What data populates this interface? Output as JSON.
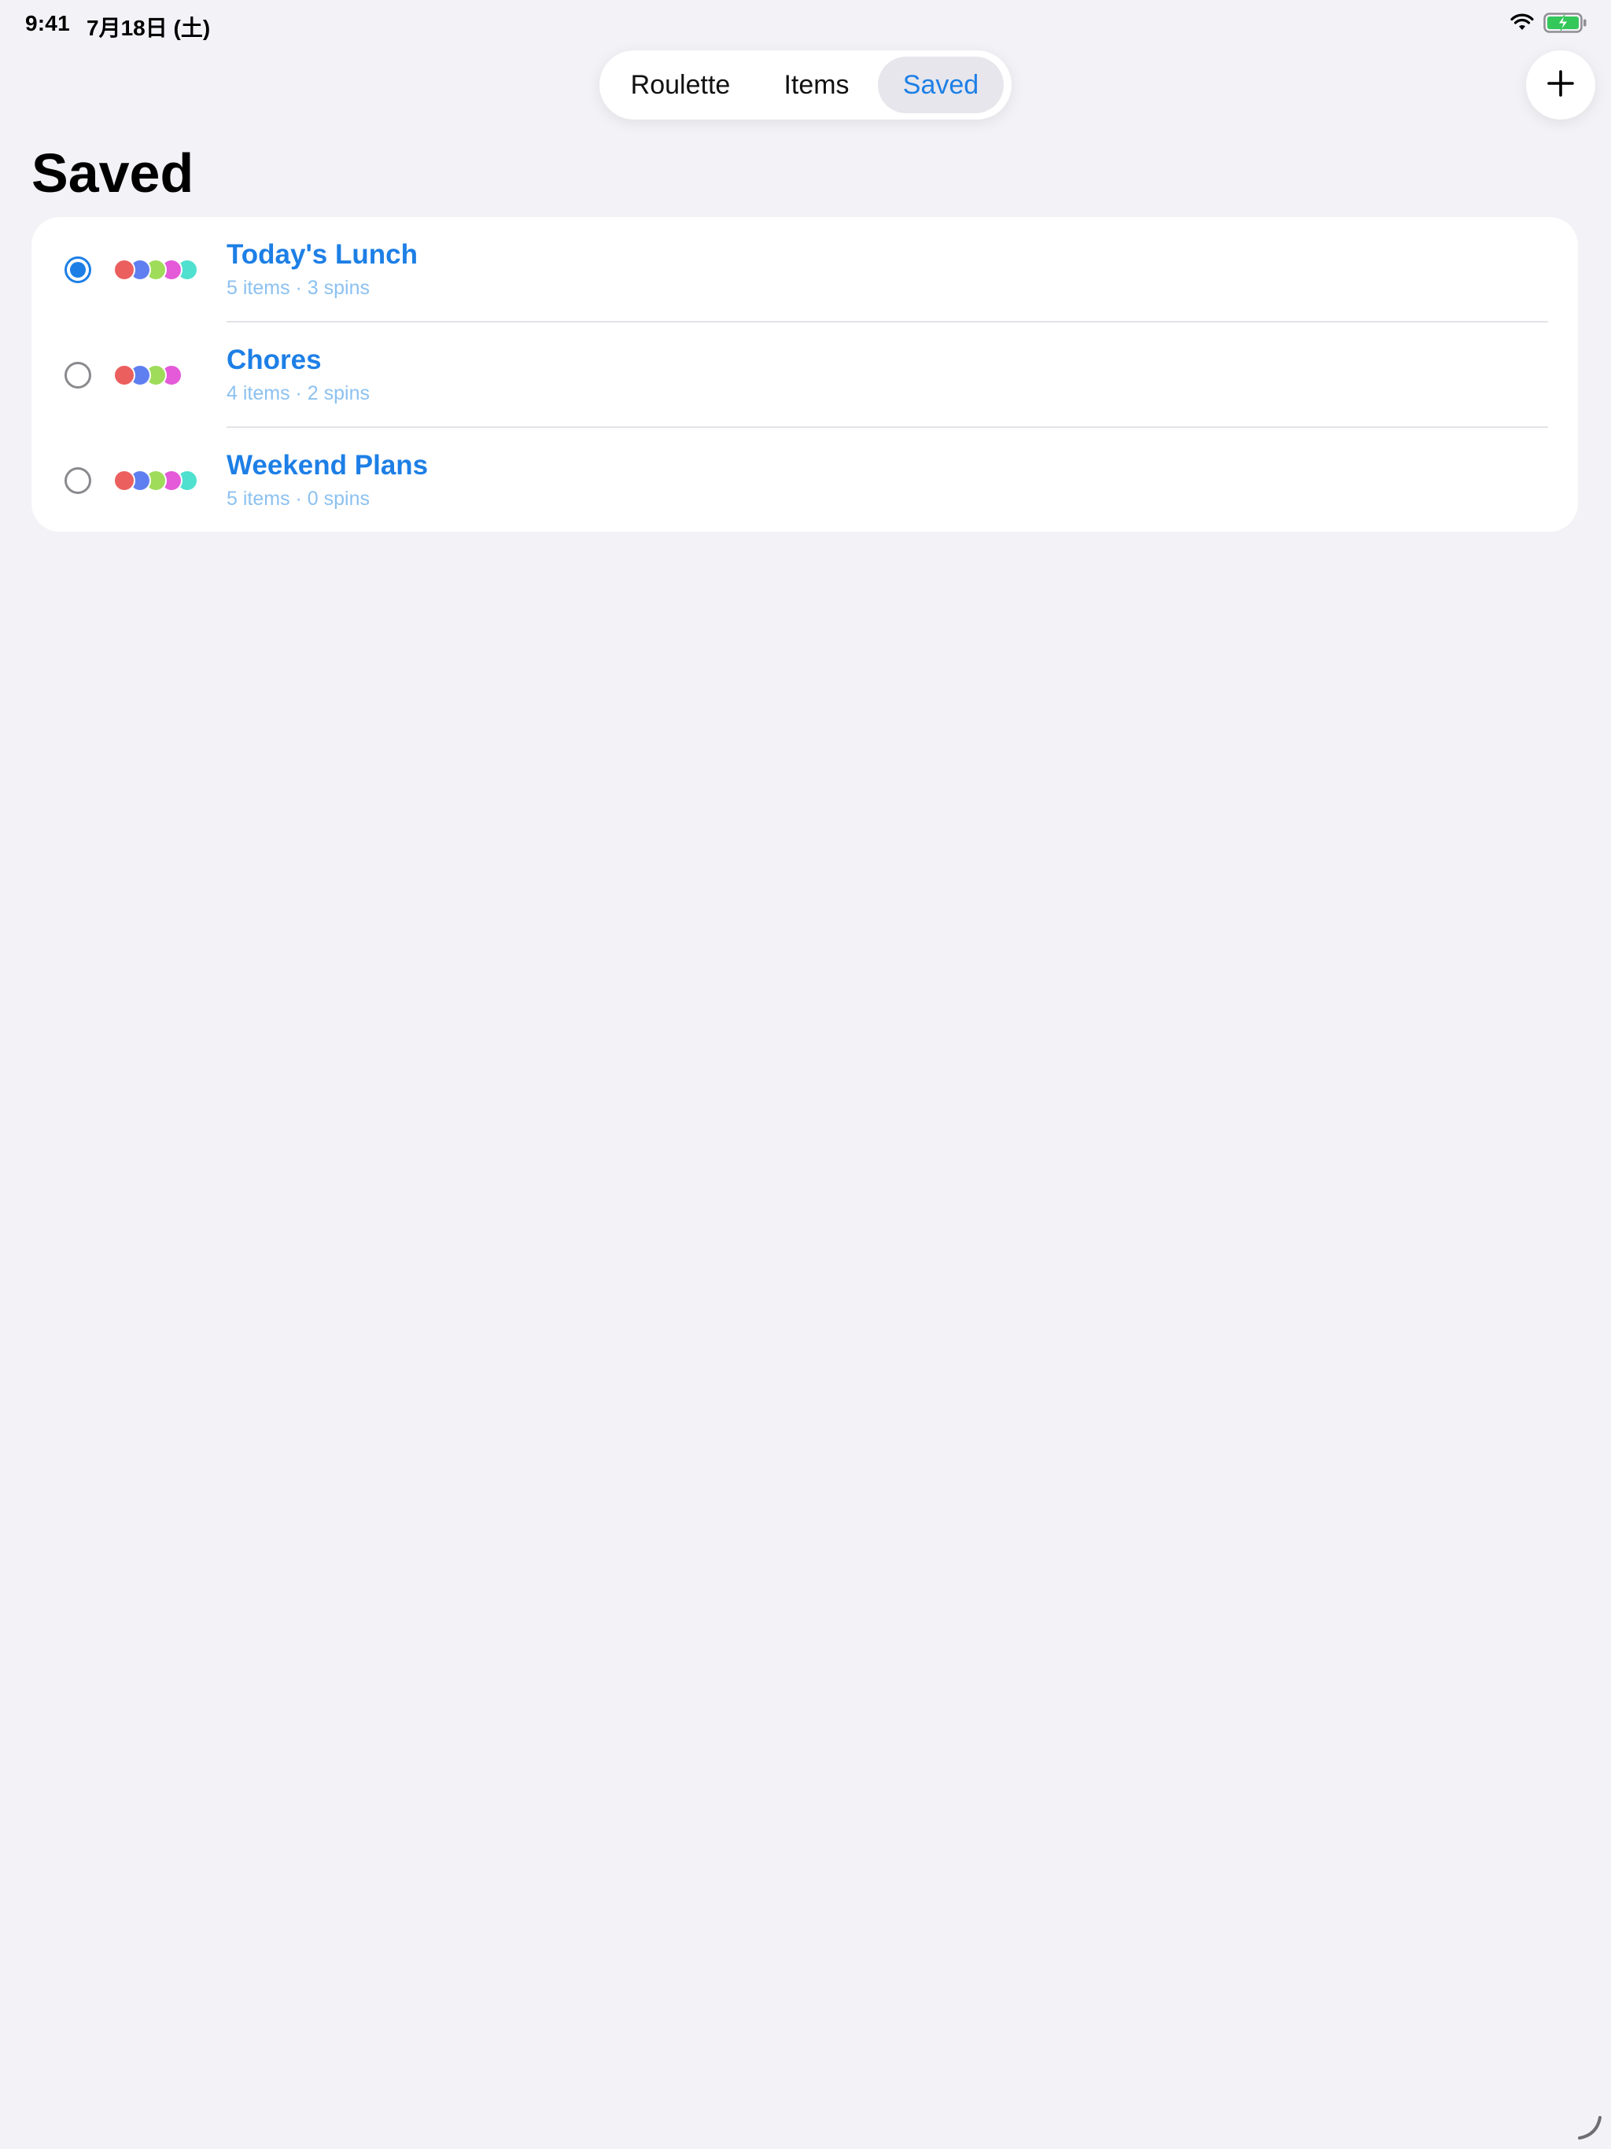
{
  "status_bar": {
    "time": "9:41",
    "date": "7月18日 (土)"
  },
  "tabs": [
    {
      "label": "Roulette"
    },
    {
      "label": "Items"
    },
    {
      "label": "Saved"
    }
  ],
  "selected_tab": "Saved",
  "add_button_icon": "plus-icon",
  "page_title": "Saved",
  "accent_color": "#1d7fe6",
  "saved_lists": [
    {
      "title": "Today's Lunch",
      "subtitle": "5 items · 3 spins",
      "selected": true,
      "colors": [
        "#ec5f5f",
        "#5f7ff0",
        "#9fdc5a",
        "#e45ad8",
        "#4fe0cf"
      ]
    },
    {
      "title": "Chores",
      "subtitle": "4 items · 2 spins",
      "selected": false,
      "colors": [
        "#ec5f5f",
        "#5f7ff0",
        "#9fdc5a",
        "#e45ad8"
      ]
    },
    {
      "title": "Weekend Plans",
      "subtitle": "5 items · 0 spins",
      "selected": false,
      "colors": [
        "#ec5f5f",
        "#5f7ff0",
        "#9fdc5a",
        "#e45ad8",
        "#4fe0cf"
      ]
    }
  ]
}
